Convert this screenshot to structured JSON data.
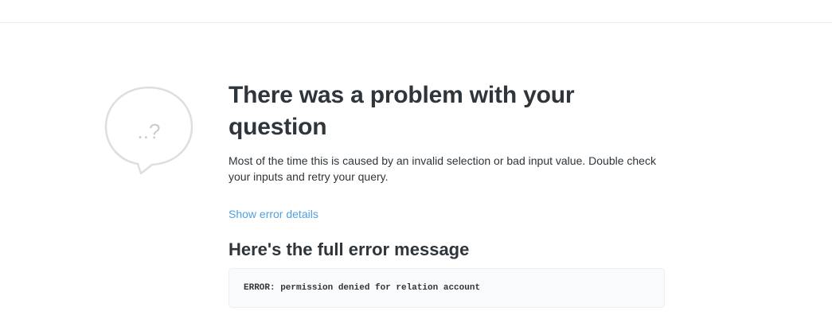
{
  "error": {
    "title": "There was a problem with your question",
    "description": "Most of the time this is caused by an invalid selection or bad input value. Double check your inputs and retry your query.",
    "show_details_link": "Show error details",
    "details_heading": "Here's the full error message",
    "message": "ERROR: permission denied for relation account",
    "icon": "speech-bubble-question-icon",
    "icon_text": "..?"
  },
  "colors": {
    "title": "#2e353b",
    "link": "#509ee3",
    "icon_stroke": "#dcdfe0",
    "error_box_bg": "#f9fafb"
  }
}
